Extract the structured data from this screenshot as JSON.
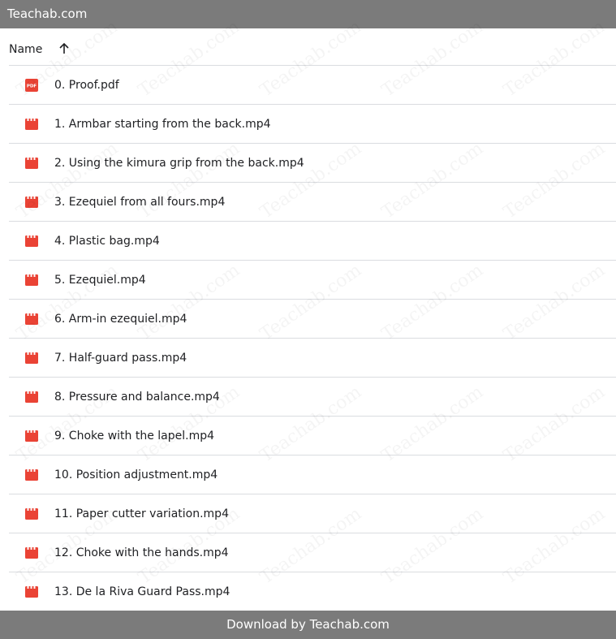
{
  "top_bar": {
    "title": "Teachab.com"
  },
  "list": {
    "header": {
      "name_label": "Name",
      "sort_icon": "arrow-up-icon"
    },
    "files": [
      {
        "name": "0. Proof.pdf",
        "type": "pdf",
        "icon": "pdf-file-icon",
        "icon_label": "PDF"
      },
      {
        "name": "1. Armbar starting from the back.mp4",
        "type": "video",
        "icon": "video-file-icon"
      },
      {
        "name": "2. Using the kimura grip from the back.mp4",
        "type": "video",
        "icon": "video-file-icon"
      },
      {
        "name": "3. Ezequiel from all fours.mp4",
        "type": "video",
        "icon": "video-file-icon"
      },
      {
        "name": "4. Plastic bag.mp4",
        "type": "video",
        "icon": "video-file-icon"
      },
      {
        "name": "5. Ezequiel.mp4",
        "type": "video",
        "icon": "video-file-icon"
      },
      {
        "name": "6. Arm-in ezequiel.mp4",
        "type": "video",
        "icon": "video-file-icon"
      },
      {
        "name": "7. Half-guard pass.mp4",
        "type": "video",
        "icon": "video-file-icon"
      },
      {
        "name": "8. Pressure and balance.mp4",
        "type": "video",
        "icon": "video-file-icon"
      },
      {
        "name": "9. Choke with the lapel.mp4",
        "type": "video",
        "icon": "video-file-icon"
      },
      {
        "name": "10. Position adjustment.mp4",
        "type": "video",
        "icon": "video-file-icon"
      },
      {
        "name": "11. Paper cutter variation.mp4",
        "type": "video",
        "icon": "video-file-icon"
      },
      {
        "name": "12. Choke with the hands.mp4",
        "type": "video",
        "icon": "video-file-icon"
      },
      {
        "name": "13. De la Riva Guard Pass.mp4",
        "type": "video",
        "icon": "video-file-icon"
      }
    ]
  },
  "watermark": {
    "text": "Teachab.com"
  },
  "bottom_bar": {
    "label": "Download by Teachab.com"
  },
  "colors": {
    "bar_background": "#7b7b7b",
    "icon_red": "#ea4335",
    "divider": "#dadce0",
    "text": "#202124"
  }
}
